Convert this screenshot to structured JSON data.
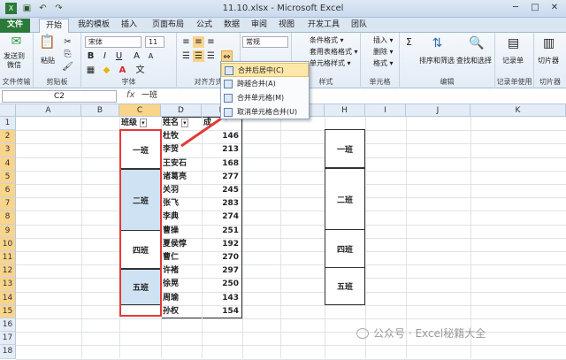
{
  "window": {
    "title": "11.10.xlsx - Microsoft Excel"
  },
  "quick_access": [
    "save-icon",
    "undo-icon",
    "redo-icon"
  ],
  "window_buttons": [
    "─",
    "□",
    "✕"
  ],
  "tabs": [
    "文件",
    "开始",
    "我的模板",
    "插入",
    "页面布局",
    "公式",
    "数据",
    "审阅",
    "视图",
    "开发工具",
    "团队"
  ],
  "ribbon": {
    "clipboard": {
      "send_label": "发送到\n微信",
      "paste_label": "粘贴",
      "group": "剪贴板",
      "file_transfer_group": "文件传输"
    },
    "font": {
      "name": "宋体",
      "size": "11",
      "group": "字体"
    },
    "align": {
      "group": "对齐方式"
    },
    "number": {
      "format": "常规",
      "group": "数字"
    },
    "styles": {
      "items": [
        "条件格式 ▾",
        "套用表格格式 ▾",
        "单元格样式 ▾"
      ],
      "group": "样式"
    },
    "cells": {
      "items": [
        "插入 ▾",
        "删除 ▾",
        "格式 ▾"
      ],
      "group": "单元格"
    },
    "edit": {
      "sort": "排序和筛选",
      "find": "查找和选择",
      "group": "编辑"
    },
    "record": {
      "label": "记录单",
      "group": "记录单使用"
    },
    "cutter": {
      "label": "切片器",
      "group": "切片器"
    }
  },
  "formula_bar": {
    "name_box": "C2",
    "fx": "fx",
    "value": "一班"
  },
  "columns": [
    "A",
    "B",
    "C",
    "D",
    "E",
    "F",
    "G",
    "H",
    "I",
    "J",
    "K"
  ],
  "rows": [
    "1",
    "2",
    "3",
    "4",
    "5",
    "6",
    "7",
    "8",
    "9",
    "10",
    "11",
    "12",
    "13",
    "14",
    "15",
    "16",
    "17",
    "18"
  ],
  "table": {
    "headers": {
      "class": "班级",
      "name": "姓名",
      "score": "成"
    },
    "names": [
      "杜牧",
      "李贺",
      "王安石",
      "诸葛亮",
      "关羽",
      "张飞",
      "李典",
      "曹操",
      "夏侯惇",
      "曹仁",
      "许褚",
      "徐晃",
      "周瑜",
      "孙权"
    ],
    "scores": [
      "146",
      "213",
      "168",
      "277",
      "245",
      "283",
      "274",
      "251",
      "192",
      "270",
      "297",
      "250",
      "143",
      "154"
    ],
    "classes": [
      "一班",
      "二班",
      "四班",
      "五班"
    ]
  },
  "side_table": [
    "一班",
    "二班",
    "四班",
    "五班"
  ],
  "merge_menu": [
    "合并后居中(C)",
    "跨越合并(A)",
    "合并单元格(M)",
    "取消单元格合并(U)"
  ],
  "watermark": "公众号 · Excel秘籍大全",
  "colors": {
    "file_tab": "#2b7a3a",
    "selected_header": "#f9d48b",
    "merged_fill": "#cfe2f3",
    "highlight": "#e53935"
  }
}
